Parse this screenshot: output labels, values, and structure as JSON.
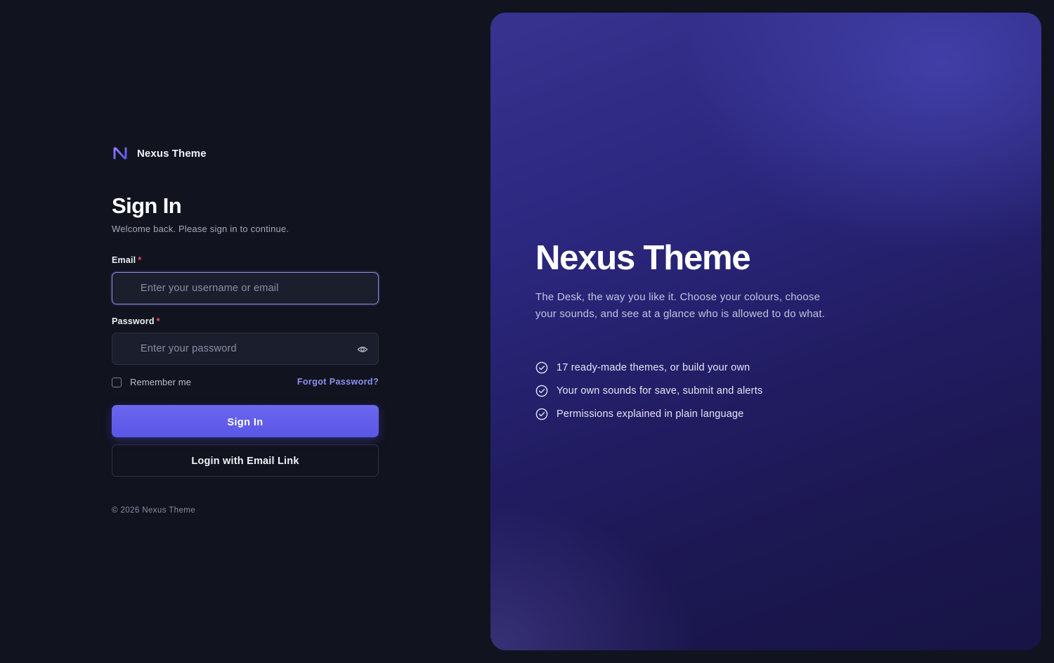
{
  "brand": {
    "name": "Nexus Theme",
    "logo_icon": "nexus-logo-icon",
    "accent": "#5a56e6"
  },
  "form": {
    "title": "Sign In",
    "subtitle": "Welcome back. Please sign in to continue.",
    "email": {
      "label": "Email",
      "required": "*",
      "value": "",
      "placeholder": "Enter your username or email"
    },
    "password": {
      "label": "Password",
      "required": "*",
      "value": "",
      "placeholder": "Enter your password",
      "toggle_icon": "eye-icon"
    },
    "remember_label": "Remember me",
    "forgot_label": "Forgot Password?",
    "signin_label": "Sign In",
    "email_link_label": "Login with Email Link"
  },
  "footer": {
    "copyright": "© 2026 Nexus Theme"
  },
  "hero": {
    "title": "Nexus Theme",
    "description": "The Desk, the way you like it. Choose your colours, choose your sounds, and see at a glance who is allowed to do what.",
    "feature_icon": "check-circle-icon",
    "features": [
      "17 ready-made themes, or build your own",
      "Your own sounds for save, submit and alerts",
      "Permissions explained in plain language"
    ]
  }
}
